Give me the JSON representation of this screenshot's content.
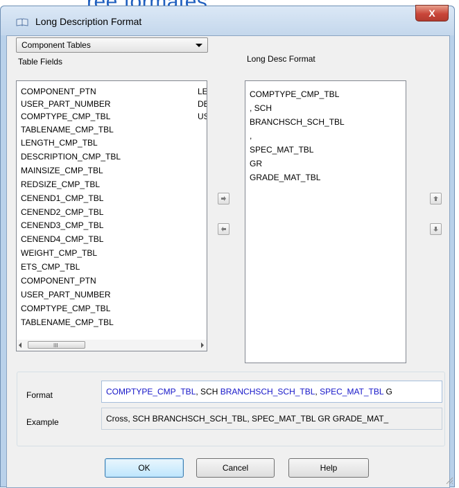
{
  "background": {
    "partial_heading": "ree formates"
  },
  "dialog": {
    "title": "Long Description Format",
    "close_symbol": "X"
  },
  "table_dropdown": {
    "selected": "Component Tables"
  },
  "table_fields": {
    "label": "Table Fields",
    "items": [
      "COMPONENT_PTN",
      "USER_PART_NUMBER",
      "COMPTYPE_CMP_TBL",
      "TABLENAME_CMP_TBL",
      "LENGTH_CMP_TBL",
      "DESCRIPTION_CMP_TBL",
      "MAINSIZE_CMP_TBL",
      "REDSIZE_CMP_TBL",
      "CENEND1_CMP_TBL",
      "CENEND2_CMP_TBL",
      "CENEND3_CMP_TBL",
      "CENEND4_CMP_TBL",
      "WEIGHT_CMP_TBL",
      "ETS_CMP_TBL",
      "COMPONENT_PTN",
      "USER_PART_NUMBER",
      "COMPTYPE_CMP_TBL",
      "TABLENAME_CMP_TBL"
    ],
    "second_column": [
      "LE",
      "DE",
      "US"
    ],
    "scroll_grip": "III"
  },
  "long_desc_format": {
    "label": "Long Desc Format",
    "items": [
      "COMPTYPE_CMP_TBL",
      ", SCH",
      "BRANCHSCH_SCH_TBL",
      ",",
      "SPEC_MAT_TBL",
      " GR",
      "GRADE_MAT_TBL"
    ]
  },
  "format_row": {
    "label": "Format",
    "segments": [
      {
        "text": "COMPTYPE_CMP_TBL",
        "color": "#1515c8"
      },
      {
        "text": ", SCH ",
        "color": "#000000"
      },
      {
        "text": "BRANCHSCH_SCH_TBL",
        "color": "#1515c8"
      },
      {
        "text": ", ",
        "color": "#000000"
      },
      {
        "text": "SPEC_MAT_TBL",
        "color": "#1515c8"
      },
      {
        "text": " G",
        "color": "#000000"
      }
    ]
  },
  "example_row": {
    "label": "Example",
    "value": "Cross, SCH BRANCHSCH_SCH_TBL, SPEC_MAT_TBL GR GRADE_MAT_"
  },
  "buttons": {
    "ok": "OK",
    "cancel": "Cancel",
    "help": "Help"
  }
}
